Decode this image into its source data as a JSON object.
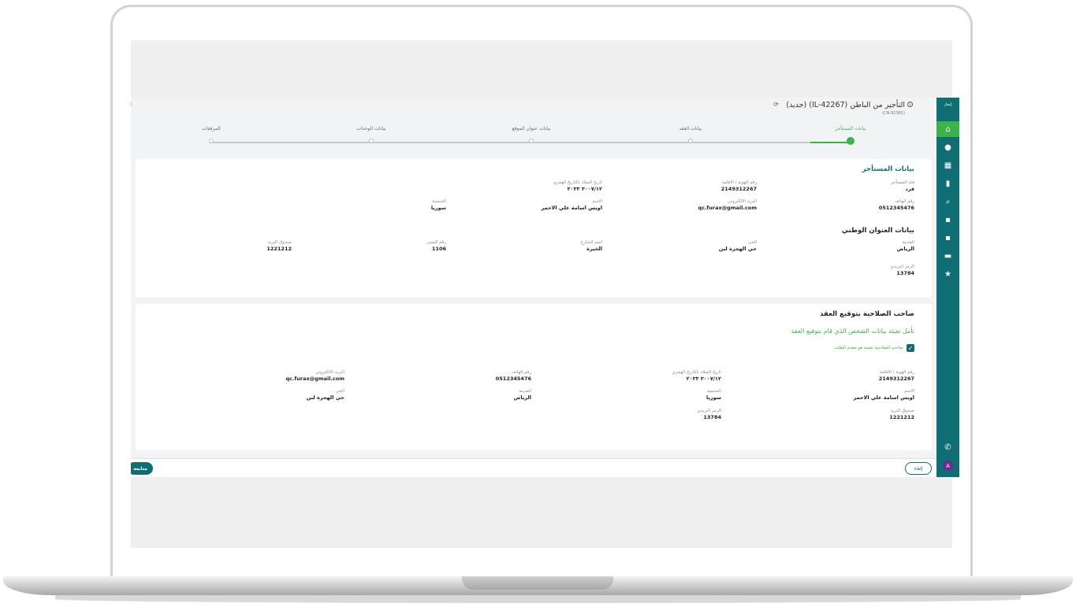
{
  "header": {
    "title": "التأجير من الباطن (IL-42267) (جديد)",
    "subtitle": "(CN-91381)",
    "refresh_icon": "refresh-icon",
    "info_icon": "info-icon"
  },
  "stepper": {
    "steps": [
      {
        "label": "بيانات المستأجر",
        "active": true
      },
      {
        "label": "بيانات العقد",
        "active": false
      },
      {
        "label": "بيانات عنوان الموقع",
        "active": false
      },
      {
        "label": "بيانات الوحدات",
        "active": false
      },
      {
        "label": "المرفقات",
        "active": false
      }
    ]
  },
  "tenant_card": {
    "title": "بيانات المستأجر",
    "fields": {
      "category": {
        "label": "فئة المستأجر",
        "value": "فرد"
      },
      "id_number": {
        "label": "رقم الهوية / الاقامة",
        "value": "2149312267"
      },
      "birth_date": {
        "label": "تاريخ الميلاد بالتاريخ الهجري",
        "value": "٣٠٠٧/١٢ ٢٠٣٣"
      },
      "mobile": {
        "label": "رقم الهاتف",
        "value": "0512345476"
      },
      "email": {
        "label": "البريد الالكتروني",
        "value": "qc.furax@gmail.com"
      },
      "name": {
        "label": "الاسم",
        "value": "اويس اسامة علي الاحمر"
      },
      "nationality": {
        "label": "الجنسية",
        "value": "سوريا"
      }
    },
    "address_title": "بيانات العنوان الوطني",
    "address": {
      "city": {
        "label": "المدينة",
        "value": "الرياض"
      },
      "district": {
        "label": "الحي",
        "value": "حي الهجرة لبن"
      },
      "street": {
        "label": "اسم الشارع",
        "value": "الخيرة"
      },
      "building": {
        "label": "رقم المبنى",
        "value": "1106"
      },
      "po_box": {
        "label": "صندوق البريد",
        "value": "1221212"
      },
      "postal": {
        "label": "الرمز البريدي",
        "value": "13784"
      }
    }
  },
  "owner_card": {
    "title": "صاحب الصلاحية بتوقيع العقد",
    "question": "تأمل تعبئة بيانات الشخص الذي قام بتوقيع العقد",
    "checkbox_label": "صاحب الصلاحية نفسه هو مقدم الطلب",
    "fields": {
      "id_number": {
        "label": "رقم الهوية / الاقامة",
        "value": "2149312267"
      },
      "birth_date": {
        "label": "تاريخ الميلاد بالتاريخ الهجري",
        "value": "٣٠٠٧/١٢ ٢٠٣٣"
      },
      "mobile": {
        "label": "رقم الهاتف",
        "value": "0512345476"
      },
      "email": {
        "label": "البريد الالكتروني",
        "value": "qc.furax@gmail.com"
      },
      "name": {
        "label": "الاسم",
        "value": "اويس اسامة علي الاحمر"
      },
      "nationality": {
        "label": "الجنسية",
        "value": "سوريا"
      },
      "city": {
        "label": "المدينة",
        "value": "الرياض"
      },
      "district": {
        "label": "الحي",
        "value": "حي الهجرة لبن"
      },
      "po_box": {
        "label": "صندوق البريد",
        "value": "1221212"
      },
      "postal": {
        "label": "الرمز البريدي",
        "value": "13784"
      }
    }
  },
  "footer": {
    "next_label": "متابعة",
    "cancel_label": "إلغاء"
  },
  "sidebar": {
    "logo_text": "إيجار",
    "avatar": "A",
    "icons": [
      "home-icon",
      "circle-icon",
      "grid-icon",
      "chart-icon",
      "search-icon",
      "document-icon",
      "file-icon",
      "chat-icon",
      "star-icon",
      "phone-icon"
    ]
  },
  "colors": {
    "primary": "#0e6e73",
    "accent": "#3cb34a",
    "avatar": "#6a2c91"
  }
}
